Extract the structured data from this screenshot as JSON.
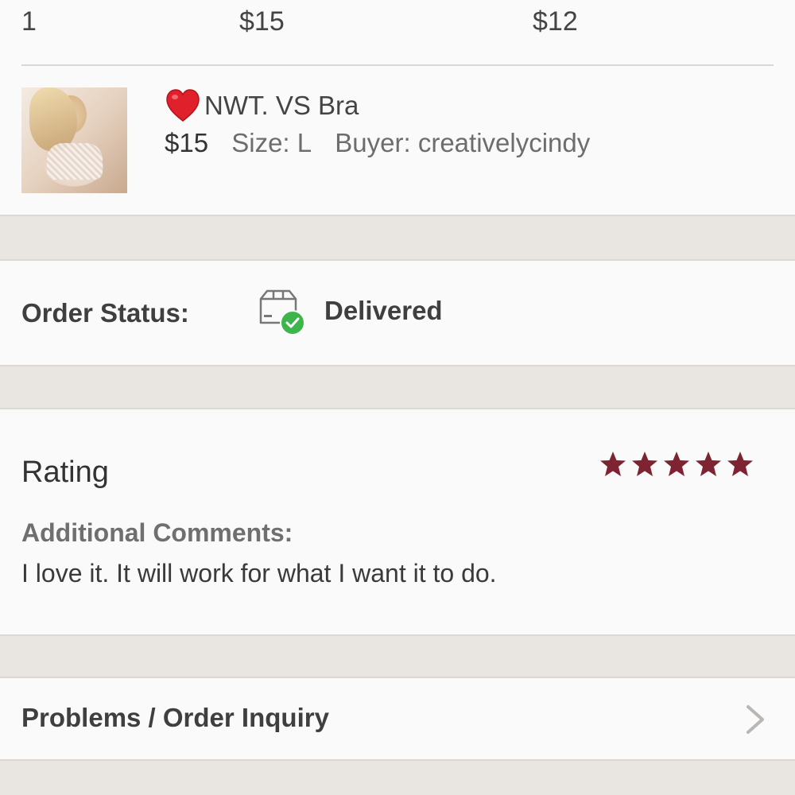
{
  "summary": {
    "quantity": "1",
    "price": "$15",
    "earnings": "$12"
  },
  "item": {
    "thumbnail_icon": "product-photo",
    "heart_icon": "red-heart-emoji",
    "title": "NWT. VS Bra",
    "price": "$15",
    "size": "Size: L",
    "buyer": "Buyer: creativelycindy"
  },
  "status": {
    "label": "Order Status:",
    "icon": "delivered-box-icon",
    "value": "Delivered",
    "check_color": "#3db54a"
  },
  "rating": {
    "title": "Rating",
    "stars": 5,
    "max_stars": 5,
    "star_color": "#7d2331",
    "comments_label": "Additional Comments:",
    "comments_text": "I love it. It will work for what I want it to do."
  },
  "problems": {
    "label": "Problems / Order Inquiry",
    "icon": "chevron-right-icon"
  }
}
